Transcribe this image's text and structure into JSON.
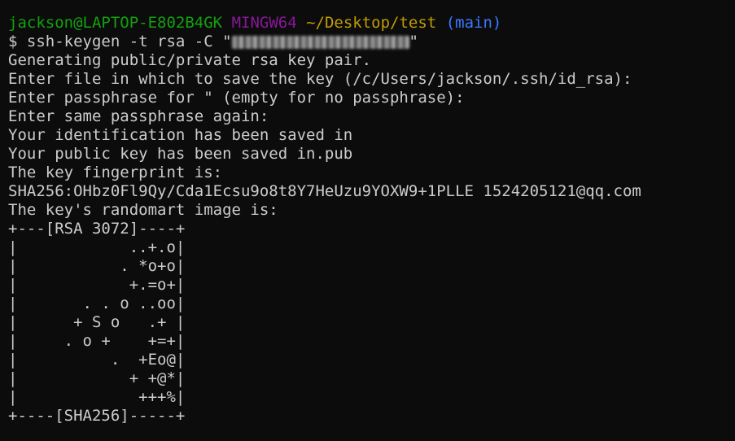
{
  "prompt": {
    "user_host": "jackson@LAPTOP-E802B4GK",
    "system": "MINGW64",
    "cwd": "~/Desktop/test",
    "branch": "(main)"
  },
  "command": {
    "text": "$ ssh-keygen -t rsa -C \"",
    "comment_redacted": true,
    "close_quote": "\""
  },
  "output": [
    "Generating public/private rsa key pair.",
    "Enter file in which to save the key (/c/Users/jackson/.ssh/id_rsa):",
    "Enter passphrase for \" (empty for no passphrase):",
    "Enter same passphrase again:",
    "Your identification has been saved in",
    "Your public key has been saved in.pub",
    "The key fingerprint is:",
    "SHA256:OHbz0Fl9Qy/Cda1Ecsu9o8t8Y7HeUzu9YOXW9+1PLLE 1524205121@qq.com",
    "The key's randomart image is:",
    "+---[RSA 3072]----+",
    "|            ..+.o|",
    "|           . *o+o|",
    "|            +.=o+|",
    "|       . . o ..oo|",
    "|      + S o   .+ |",
    "|     . o +    +=+|",
    "|          .  +Eo@|",
    "|            + +@*|",
    "|             +++%|",
    "+----[SHA256]-----+"
  ]
}
